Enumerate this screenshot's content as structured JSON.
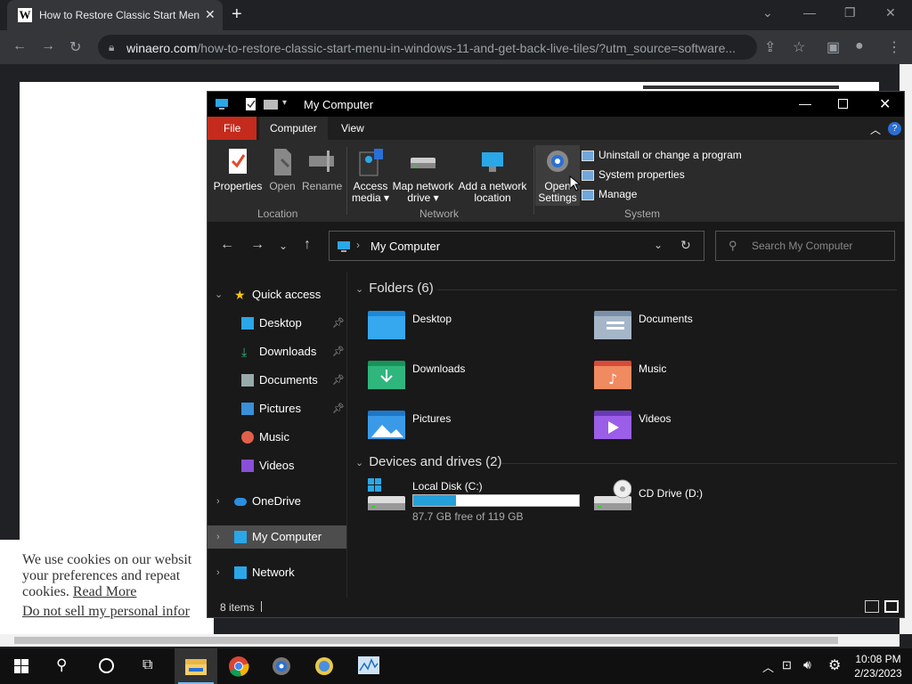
{
  "browser": {
    "tab_title": "How to Restore Classic Start Menu",
    "url_domain": "winaero.com",
    "url_path": "/how-to-restore-classic-start-menu-in-windows-11-and-get-back-live-tiles/?utm_source=software..."
  },
  "cookie": {
    "line1": "We use cookies on our websit",
    "line2": "your preferences and repeat",
    "line3": "cookies.",
    "read_more": "Read More",
    "dns": "Do not sell my personal infor"
  },
  "explorer": {
    "title": "My Computer",
    "ribbon_tabs": [
      "File",
      "Computer",
      "View"
    ],
    "location": {
      "group": "Location",
      "properties": "Properties",
      "open": "Open",
      "rename": "Rename"
    },
    "network": {
      "group": "Network",
      "access_media_1": "Access",
      "access_media_2": "media",
      "map_1": "Map network",
      "map_2": "drive",
      "add_1": "Add a network",
      "add_2": "location"
    },
    "system": {
      "group": "System",
      "open_settings_1": "Open",
      "open_settings_2": "Settings",
      "uninstall": "Uninstall or change a program",
      "sys_props": "System properties",
      "manage": "Manage"
    },
    "address": "My Computer",
    "search_placeholder": "Search My Computer",
    "sidebar": {
      "quick_access": "Quick access",
      "desktop": "Desktop",
      "downloads": "Downloads",
      "documents": "Documents",
      "pictures": "Pictures",
      "music": "Music",
      "videos": "Videos",
      "onedrive": "OneDrive",
      "mycomputer": "My Computer",
      "network": "Network"
    },
    "folders_header": "Folders (6)",
    "folders": [
      "Desktop",
      "Documents",
      "Downloads",
      "Music",
      "Pictures",
      "Videos"
    ],
    "devices_header": "Devices and drives (2)",
    "drive_c": {
      "name": "Local Disk (C:)",
      "free": "87.7 GB free of 119 GB",
      "used_fraction": 0.26
    },
    "drive_d": {
      "name": "CD Drive (D:)"
    },
    "status": "8 items"
  },
  "taskbar": {
    "time": "10:08 PM",
    "date": "2/23/2023"
  },
  "colors": {
    "file_tab": "#c42b1c",
    "accent": "#2aa7e8"
  }
}
